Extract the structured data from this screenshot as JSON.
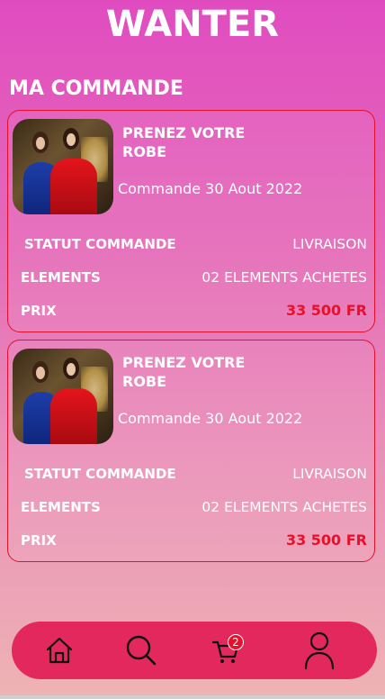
{
  "app": {
    "brand": "WANTER"
  },
  "page": {
    "title": "MA COMMANDE"
  },
  "orders": [
    {
      "product_title": "PRENEZ VOTRE ROBE",
      "order_date": "Commande 30 Aout 2022",
      "status_label": "STATUT COMMANDE",
      "status_value": "LIVRAISON",
      "elements_label": "ELEMENTS",
      "elements_value": "02 ELEMENTS ACHETES",
      "price_label": "PRIX",
      "price_value": "33 500 FR"
    },
    {
      "product_title": "PRENEZ VOTRE ROBE",
      "order_date": "Commande 30 Aout 2022",
      "status_label": "STATUT COMMANDE",
      "status_value": "LIVRAISON",
      "elements_label": "ELEMENTS",
      "elements_value": "02 ELEMENTS ACHETES",
      "price_label": "PRIX",
      "price_value": "33 500 FR"
    }
  ],
  "nav": {
    "items": [
      {
        "icon": "home-icon"
      },
      {
        "icon": "search-icon"
      },
      {
        "icon": "cart-icon",
        "badge": "2"
      },
      {
        "icon": "user-icon"
      }
    ]
  },
  "colors": {
    "accent": "#e2285c",
    "price": "#e8102a",
    "card_border": "#e8102a"
  }
}
